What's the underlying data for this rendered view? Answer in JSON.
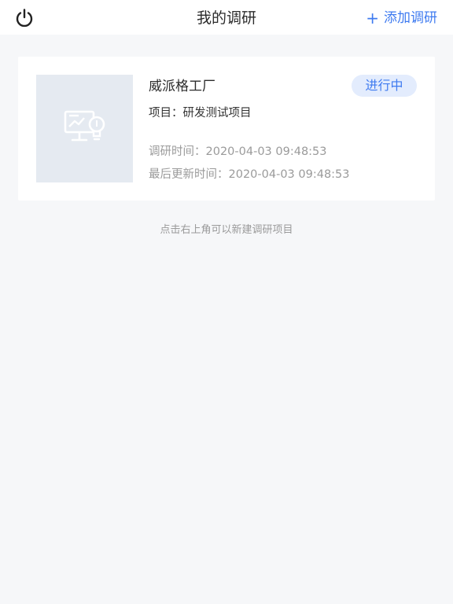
{
  "navbar": {
    "title": "我的调研",
    "add_plus": "+",
    "add_label": "添加调研",
    "power_icon": "power-icon"
  },
  "colors": {
    "accent": "#3f7bf0",
    "badge_bg": "#e3ecfd",
    "thumb_bg": "#e5eaf1",
    "page_bg": "#f6f7f9"
  },
  "survey_card": {
    "thumbnail_icon": "monitor-lightbulb-icon",
    "title": "威派格工厂",
    "status": "进行中",
    "project_label": "项目：",
    "project_value": "研发测试项目",
    "survey_time_label": "调研时间：",
    "survey_time_value": "2020-04-03 09:48:53",
    "updated_time_label": "最后更新时间：",
    "updated_time_value": "2020-04-03 09:48:53"
  },
  "hint": "点击右上角可以新建调研项目"
}
